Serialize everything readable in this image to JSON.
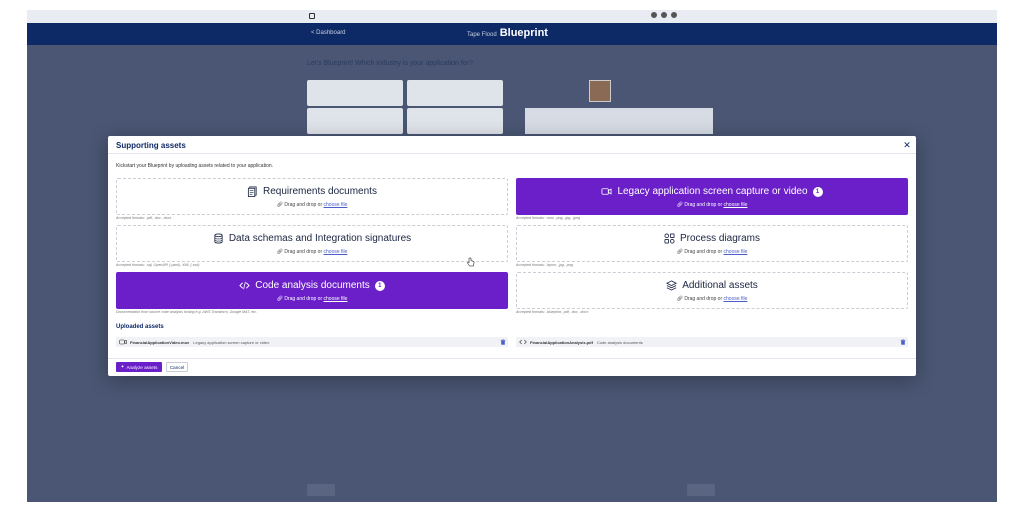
{
  "modal": {
    "title": "Supporting assets",
    "intro": "Kickstart your Blueprint by uploading assets related to your application.",
    "drag_text": "Drag and drop or ",
    "choose_link": "choose file",
    "tiles": [
      {
        "title": "Requirements documents",
        "formats": "Accepted formats: .pdf, .doc, .docx",
        "active": false,
        "icon": "document-icon"
      },
      {
        "title": "Legacy application screen capture or video",
        "formats": "Accepted formats: .mov, .png, .jpg, .jpeg",
        "active": true,
        "count": "1",
        "icon": "video-camera-icon"
      },
      {
        "title": "Data schemas and Integration signatures",
        "formats": "Accepted formats: .sql, OpenAPI (.yaml), XML (.xsd)",
        "active": false,
        "icon": "database-icon"
      },
      {
        "title": "Process diagrams",
        "formats": "Accepted formats: .bpmn, .jpg, .png",
        "active": false,
        "icon": "diagram-icon"
      },
      {
        "title": "Code analysis documents",
        "formats": "Documentation from source code analysis tooling e.g. AWS Transform, Google MAT, etc.",
        "active": true,
        "count": "1",
        "icon": "code-icon"
      },
      {
        "title": "Additional assets",
        "formats": "Accepted formats: .blueprint, .pdf, .doc, .docx",
        "active": false,
        "icon": "layers-icon"
      }
    ],
    "uploaded_title": "Uploaded assets",
    "uploaded": [
      {
        "filename": "FinancialApplicationVideo.mov",
        "type": "Legacy application screen capture or video"
      },
      {
        "filename": "FinancialApplicationAnalysis.pdf",
        "type": "Code analysis documents"
      }
    ],
    "analyze_label": "Analyze assets",
    "cancel_label": "Cancel",
    "close_glyph": "✕"
  },
  "background": {
    "back_label": "< Dashboard",
    "brand_prefix": "Tape Flood",
    "brand": "Blueprint",
    "question": "Let's Blueprint! Which industry is your application for?"
  },
  "colors": {
    "accent": "#6a1fc9",
    "navy": "#0e2a66",
    "overlay": "#4a5673"
  }
}
